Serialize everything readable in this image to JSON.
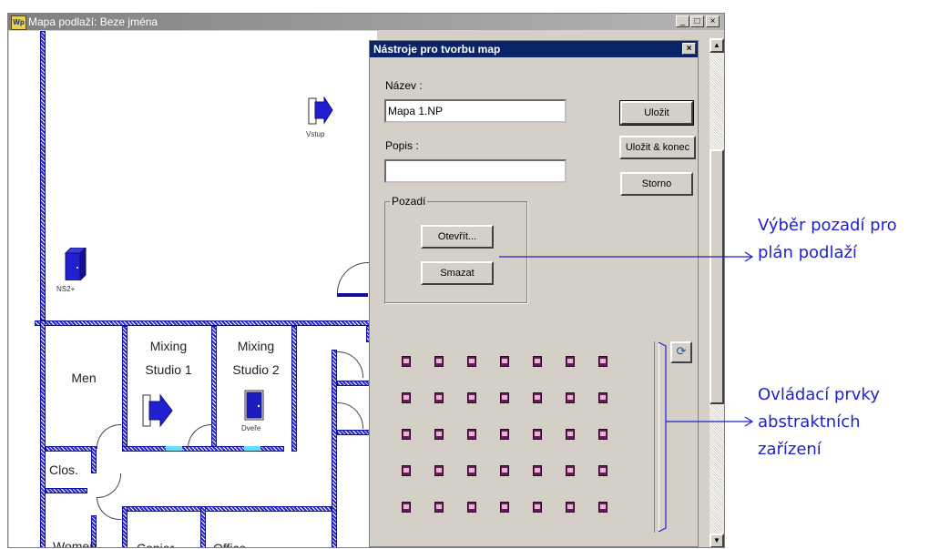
{
  "window": {
    "title": "Mapa podlaží: Beze jména",
    "icon_text": "Wp",
    "minimize_glyph": "_",
    "maximize_glyph": "□",
    "close_glyph": "×"
  },
  "floor_plan": {
    "exit_label": "Vstup",
    "ns2_label": "NS2+",
    "door_label": "Dveře",
    "rooms": {
      "men": "Men",
      "mixing1_line1": "Mixing",
      "mixing1_line2": "Studio 1",
      "mixing2_line1": "Mixing",
      "mixing2_line2": "Studio 2",
      "clos": "Clos.",
      "women": "Women",
      "copier": "Copier",
      "office": "Office"
    }
  },
  "dialog": {
    "title": "Nástroje pro tvorbu map",
    "close_glyph": "×",
    "name_label": "Název :",
    "name_value": "Mapa 1.NP",
    "desc_label": "Popis :",
    "desc_value": "",
    "save_button": "Uložit",
    "save_close_button": "Uložit & konec",
    "cancel_button": "Storno",
    "background_group": "Pozadí",
    "open_button": "Otevřít...",
    "delete_button": "Smazat",
    "palette_rows": 5,
    "palette_cols": 7,
    "icon_color": "#6e1a5a"
  },
  "annotations": {
    "background": "Výběr pozadí pro plán podlaží",
    "background_line1": "Výběr pozadí pro",
    "background_line2": "plán podlaží",
    "controls_line1": "Ovládací prvky",
    "controls_line2": "abstraktních",
    "controls_line3": "zařízení",
    "color": "#1f1fd0"
  }
}
